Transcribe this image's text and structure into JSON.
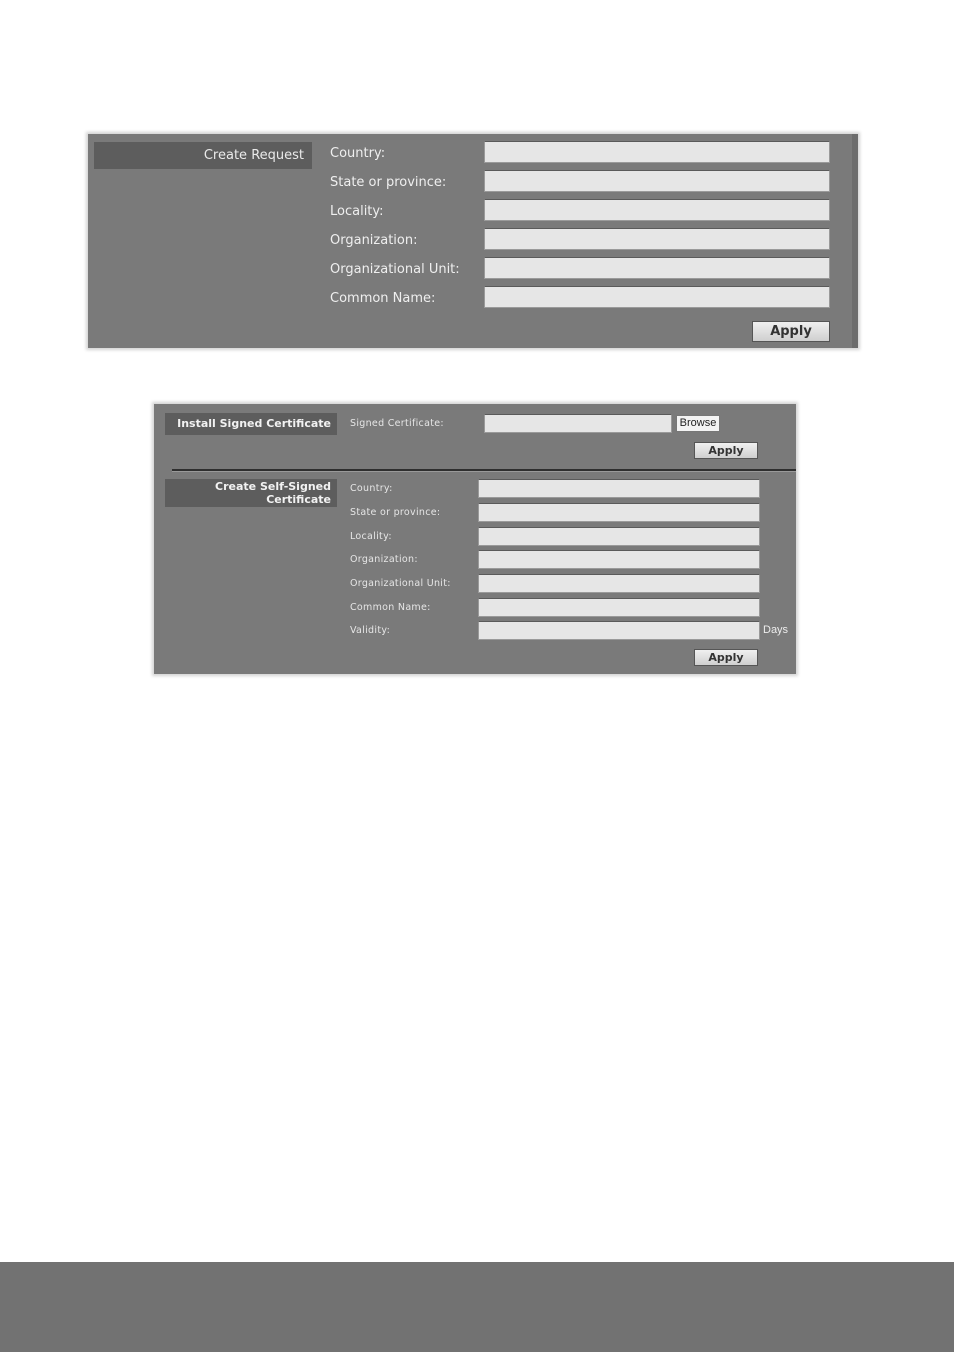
{
  "create_request": {
    "section_title": "Create Request",
    "fields": [
      {
        "label": "Country:",
        "value": ""
      },
      {
        "label": "State or province:",
        "value": ""
      },
      {
        "label": "Locality:",
        "value": ""
      },
      {
        "label": "Organization:",
        "value": ""
      },
      {
        "label": "Organizational Unit:",
        "value": ""
      },
      {
        "label": "Common Name:",
        "value": ""
      }
    ],
    "apply_label": "Apply"
  },
  "install_signed": {
    "section_title": "Install Signed Certificate",
    "field_label": "Signed Certificate:",
    "field_value": "",
    "browse_label": "Browse",
    "apply_label": "Apply"
  },
  "self_signed": {
    "section_title": "Create Self-Signed Certificate",
    "fields": [
      {
        "label": "Country:",
        "value": ""
      },
      {
        "label": "State or province:",
        "value": ""
      },
      {
        "label": "Locality:",
        "value": ""
      },
      {
        "label": "Organization:",
        "value": ""
      },
      {
        "label": "Organizational Unit:",
        "value": ""
      },
      {
        "label": "Common Name:",
        "value": ""
      },
      {
        "label": "Validity:",
        "value": ""
      }
    ],
    "validity_unit": "Days",
    "apply_label": "Apply"
  }
}
